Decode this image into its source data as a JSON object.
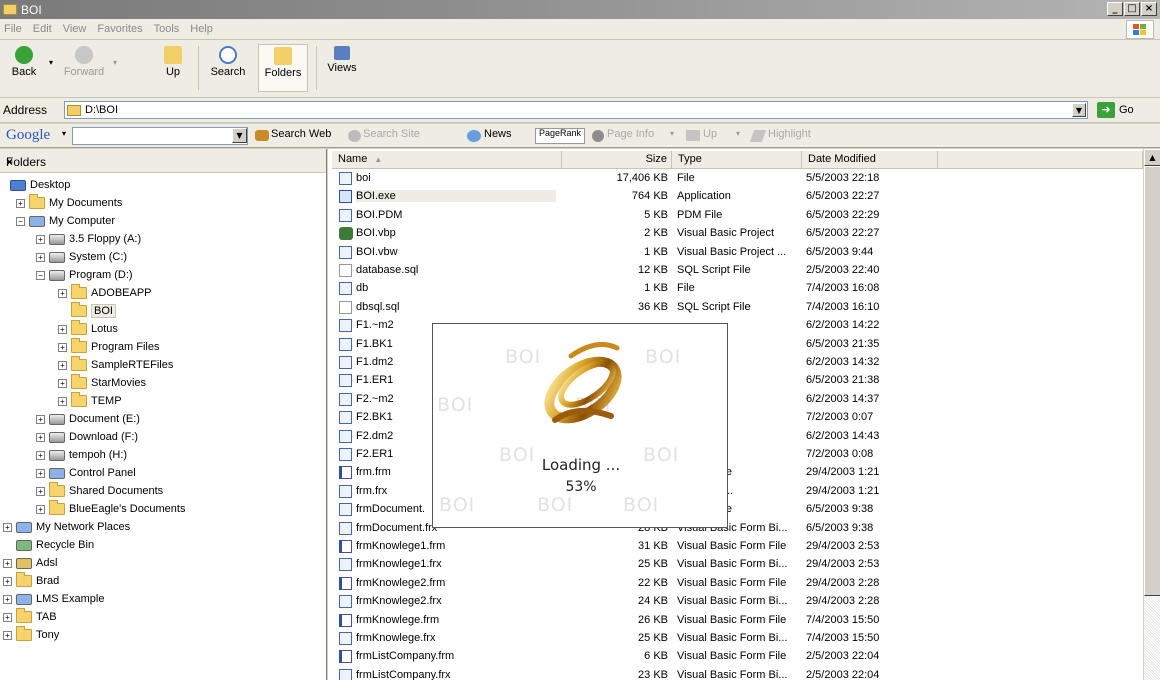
{
  "window": {
    "title": "BOI"
  },
  "menu": [
    "File",
    "Edit",
    "View",
    "Favorites",
    "Tools",
    "Help"
  ],
  "toolbar": {
    "back": "Back",
    "forward": "Forward",
    "up": "Up",
    "search": "Search",
    "folders": "Folders",
    "views": "Views"
  },
  "address": {
    "label": "Address",
    "value": "D:\\BOI",
    "go": "Go"
  },
  "google": {
    "logo": "Google",
    "search_web": "Search Web",
    "search_site": "Search Site",
    "news": "News",
    "pagerank": "PageRank",
    "page_info": "Page Info",
    "up": "Up",
    "highlight": "Highlight"
  },
  "folders": {
    "title": "Folders",
    "items": [
      {
        "label": "Desktop"
      },
      {
        "label": "My Documents"
      },
      {
        "label": "My Computer"
      },
      {
        "label": "3.5 Floppy (A:)"
      },
      {
        "label": "System (C:)"
      },
      {
        "label": "Program (D:)"
      },
      {
        "label": "ADOBEAPP"
      },
      {
        "label": "BOI"
      },
      {
        "label": "Lotus"
      },
      {
        "label": "Program Files"
      },
      {
        "label": "SampleRTEFiles"
      },
      {
        "label": "StarMovies"
      },
      {
        "label": "TEMP"
      },
      {
        "label": "Document (E:)"
      },
      {
        "label": "Download (F:)"
      },
      {
        "label": "tempoh (H:)"
      },
      {
        "label": "Control Panel"
      },
      {
        "label": "Shared Documents"
      },
      {
        "label": "BlueEagle's Documents"
      },
      {
        "label": "My Network Places"
      },
      {
        "label": "Recycle Bin"
      },
      {
        "label": "Adsl"
      },
      {
        "label": "Brad"
      },
      {
        "label": "LMS Example"
      },
      {
        "label": "TAB"
      },
      {
        "label": "Tony"
      }
    ]
  },
  "columns": {
    "name": "Name",
    "size": "Size",
    "type": "Type",
    "date": "Date Modified"
  },
  "files": [
    {
      "name": "boi",
      "size": "17,406 KB",
      "type": "File",
      "date": "5/5/2003 22:18"
    },
    {
      "name": "BOI.exe",
      "size": "764 KB",
      "type": "Application",
      "date": "6/5/2003 22:27"
    },
    {
      "name": "BOI.PDM",
      "size": "5 KB",
      "type": "PDM File",
      "date": "6/5/2003 22:29"
    },
    {
      "name": "BOI.vbp",
      "size": "2 KB",
      "type": "Visual Basic Project",
      "date": "6/5/2003 22:27"
    },
    {
      "name": "BOI.vbw",
      "size": "1 KB",
      "type": "Visual Basic Project ...",
      "date": "6/5/2003 9:44"
    },
    {
      "name": "database.sql",
      "size": "12 KB",
      "type": "SQL Script File",
      "date": "2/5/2003 22:40"
    },
    {
      "name": "db",
      "size": "1 KB",
      "type": "File",
      "date": "7/4/2003 16:08"
    },
    {
      "name": "dbsql.sql",
      "size": "36 KB",
      "type": "SQL Script File",
      "date": "7/4/2003 16:10"
    },
    {
      "name": "F1.~m2",
      "size": "",
      "type": "",
      "date": "6/2/2003 14:22"
    },
    {
      "name": "F1.BK1",
      "size": "",
      "type": "",
      "date": "6/5/2003 21:35"
    },
    {
      "name": "F1.dm2",
      "size": "",
      "type": "",
      "date": "6/2/2003 14:32"
    },
    {
      "name": "F1.ER1",
      "size": "",
      "type": "",
      "date": "6/5/2003 21:38"
    },
    {
      "name": "F2.~m2",
      "size": "",
      "type": "",
      "date": "6/2/2003 14:37"
    },
    {
      "name": "F2.BK1",
      "size": "",
      "type": "",
      "date": "7/2/2003 0:07"
    },
    {
      "name": "F2.dm2",
      "size": "",
      "type": "",
      "date": "6/2/2003 14:43"
    },
    {
      "name": "F2.ER1",
      "size": "",
      "type": "",
      "date": "7/2/2003 0:08"
    },
    {
      "name": "frm.frm",
      "size": "",
      "type": "c Form File",
      "date": "29/4/2003 1:21"
    },
    {
      "name": "frm.frx",
      "size": "",
      "type": "c Form Bi...",
      "date": "29/4/2003 1:21"
    },
    {
      "name": "frmDocument.",
      "size": "",
      "type": "c Form File",
      "date": "6/5/2003 9:38"
    },
    {
      "name": "frmDocument.frx",
      "size": "28 KB",
      "type": "Visual Basic Form Bi...",
      "date": "6/5/2003 9:38"
    },
    {
      "name": "frmKnowlege1.frm",
      "size": "31 KB",
      "type": "Visual Basic Form File",
      "date": "29/4/2003 2:53"
    },
    {
      "name": "frmKnowlege1.frx",
      "size": "25 KB",
      "type": "Visual Basic Form Bi...",
      "date": "29/4/2003 2:53"
    },
    {
      "name": "frmKnowlege2.frm",
      "size": "22 KB",
      "type": "Visual Basic Form File",
      "date": "29/4/2003 2:28"
    },
    {
      "name": "frmKnowlege2.frx",
      "size": "24 KB",
      "type": "Visual Basic Form Bi...",
      "date": "29/4/2003 2:28"
    },
    {
      "name": "frmKnowlege.frm",
      "size": "26 KB",
      "type": "Visual Basic Form File",
      "date": "7/4/2003 15:50"
    },
    {
      "name": "frmKnowlege.frx",
      "size": "25 KB",
      "type": "Visual Basic Form Bi...",
      "date": "7/4/2003 15:50"
    },
    {
      "name": "frmListCompany.frm",
      "size": "6 KB",
      "type": "Visual Basic Form File",
      "date": "2/5/2003 22:04"
    },
    {
      "name": "frmListCompany.frx",
      "size": "23 KB",
      "type": "Visual Basic Form Bi...",
      "date": "2/5/2003 22:04"
    }
  ],
  "splash": {
    "watermark": "BOI",
    "loading": "Loading ...",
    "percent": "53%"
  }
}
